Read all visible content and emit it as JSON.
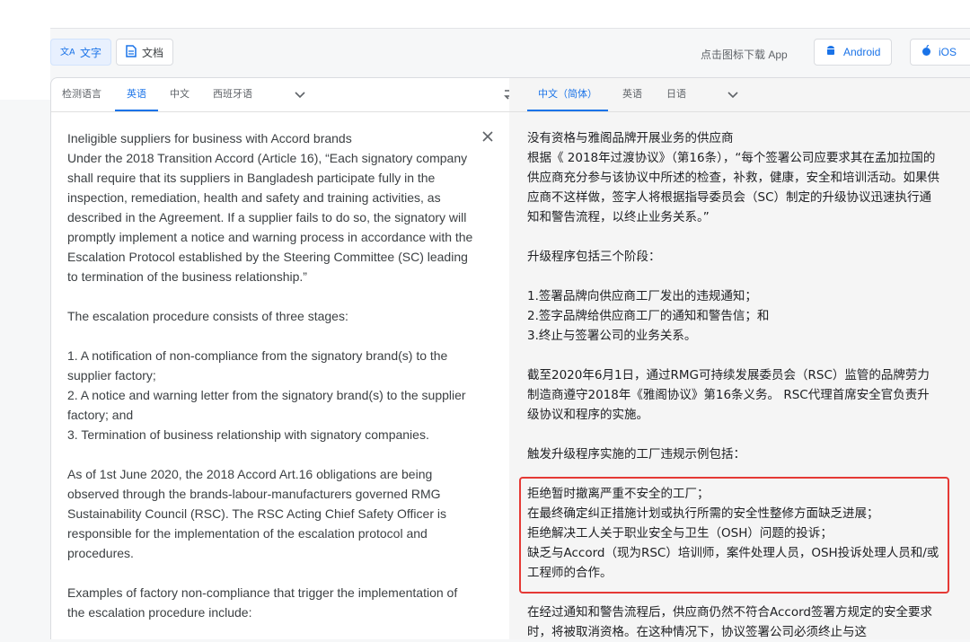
{
  "toolbar": {
    "text_mode": "文字",
    "doc_mode": "文档",
    "download_text": "点击图标下载 App",
    "android": "Android",
    "ios": "iOS"
  },
  "source_langs": [
    "检测语言",
    "英语",
    "中文",
    "西班牙语"
  ],
  "target_langs": [
    "中文（简体）",
    "英语",
    "日语"
  ],
  "source_text": "Ineligible suppliers for business with Accord brands\nUnder the 2018 Transition Accord (Article 16), “Each signatory company shall require that its suppliers in Bangladesh participate fully in the inspection, remediation, health and safety and training activities, as described in the Agreement. If a supplier fails to do so, the signatory will promptly implement a notice and warning process in accordance with the Escalation Protocol established by the Steering Committee (SC) leading to termination of the business relationship.”\n\nThe escalation procedure consists of three stages:\n\n1. A notification of non-compliance from the signatory brand(s) to the supplier factory;\n2. A notice and warning letter from the signatory brand(s) to the supplier factory; and\n3. Termination of business relationship with signatory companies.\n\nAs of 1st June 2020, the 2018 Accord Art.16 obligations are being observed through the brands-labour-manufacturers governed RMG Sustainability Council (RSC). The RSC Acting Chief Safety Officer is responsible for the implementation of the escalation protocol and procedures.\n\nExamples of factory non-compliance that trigger the implementation of the escalation procedure include:",
  "target_text": "没有资格与雅阁品牌开展业务的供应商\n根据《 2018年过渡协议》（第16条），“每个签署公司应要求其在孟加拉国的供应商充分参与该协议中所述的检查，补救，健康，安全和培训活动。如果供应商不这样做，签字人将根据指导委员会（SC）制定的升级协议迅速执行通知和警告流程，以终止业务关系。”\n\n升级程序包括三个阶段：\n\n1.签署品牌向供应商工厂发出的违规通知；\n2.签字品牌给供应商工厂的通知和警告信；和\n3.终止与签署公司的业务关系。\n\n截至2020年6月1日，通过RMG可持续发展委员会（RSC）监管的品牌劳力制造商遵守2018年《雅阁协议》第16条义务。 RSC代理首席安全官负责升级协议和程序的实施。\n\n触发升级程序实施的工厂违规示例包括：\n\n拒绝暂时撤离严重不安全的工厂；\n在最终确定纠正措施计划或执行所需的安全性整修方面缺乏进展；\n拒绝解决工人关于职业安全与卫生（OSH）问题的投诉；\n缺乏与Accord（现为RSC）培训师，案件处理人员，OSH投诉处理人员和/或工程师的合作。\n\n在经过通知和警告流程后，供应商仍然不符合Accord签署方规定的安全要求时，将被取消资格。在这种情况下，协议签署公司必须终止与这",
  "colors": {
    "accent": "#1a73e8",
    "highlight": "#e53935"
  }
}
